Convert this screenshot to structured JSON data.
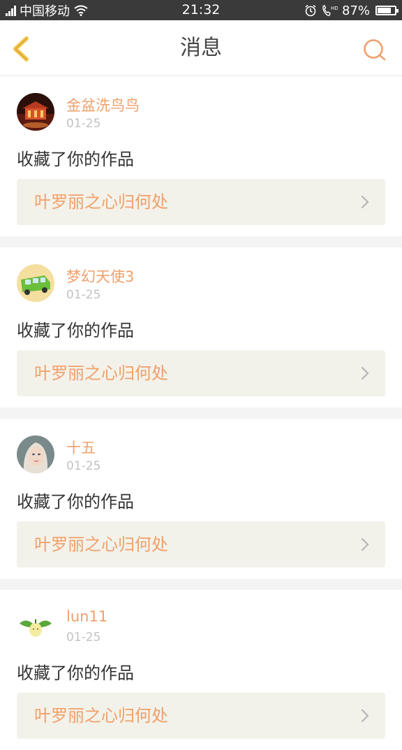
{
  "status_bar": {
    "carrier": "中国移动",
    "time": "21:32",
    "battery_percent": "87%",
    "battery_level": 0.87
  },
  "header": {
    "title": "消息",
    "back_icon": "chevron-left-icon",
    "search_icon": "search-icon"
  },
  "colors": {
    "accent": "#f0a06a",
    "status_bar_bg": "#3a3a3a",
    "card_bg": "#f3f2ea",
    "separator": "#f4f4f4"
  },
  "messages": [
    {
      "username": "金盆洗鸟鸟",
      "date": "01-25",
      "action": "收藏了你的作品",
      "work_title": "叶罗丽之心归何处"
    },
    {
      "username": "梦幻天使3",
      "date": "01-25",
      "action": "收藏了你的作品",
      "work_title": "叶罗丽之心归何处"
    },
    {
      "username": "十五",
      "date": "01-25",
      "action": "收藏了你的作品",
      "work_title": "叶罗丽之心归何处"
    },
    {
      "username": "lun11",
      "date": "01-25",
      "action": "收藏了你的作品",
      "work_title": "叶罗丽之心归何处"
    }
  ]
}
